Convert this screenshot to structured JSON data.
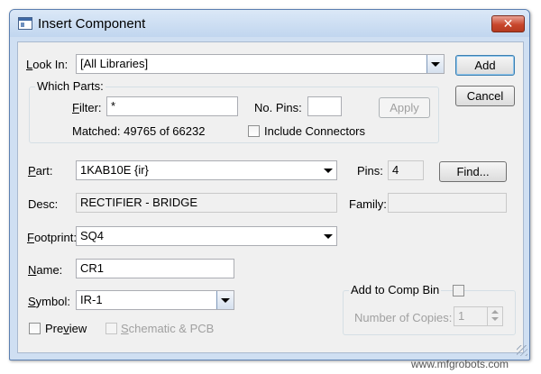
{
  "window": {
    "title": "Insert Component",
    "close_glyph": "✕"
  },
  "look_in": {
    "label_pre": "",
    "label_u": "L",
    "label_post": "ook In:",
    "value": "[All Libraries]"
  },
  "buttons": {
    "add": "Add",
    "cancel": "Cancel",
    "apply": "Apply",
    "find": "Find..."
  },
  "which_parts": {
    "title": "Which Parts:",
    "filter_label_u": "F",
    "filter_label_post": "ilter:",
    "filter_value": "*",
    "no_pins_label": "No. Pins:",
    "no_pins_value": "",
    "matched": "Matched: 49765 of 66232",
    "include_connectors": "Include Connectors"
  },
  "part": {
    "label_u": "P",
    "label_post": "art:",
    "value": "1KAB10E {ir}"
  },
  "pins": {
    "label": "Pins:",
    "value": "4"
  },
  "desc": {
    "label": "Desc:",
    "value": "RECTIFIER - BRIDGE"
  },
  "family": {
    "label": "Family:",
    "value": ""
  },
  "footprint": {
    "label_u": "F",
    "label_post": "ootprint:",
    "value": "SQ4"
  },
  "name": {
    "label_u": "N",
    "label_post": "ame:",
    "value": "CR1"
  },
  "symbol": {
    "label_u": "S",
    "label_post": "ymbol:",
    "value": "IR-1"
  },
  "preview": {
    "label_pre": "Pre",
    "label_u": "v",
    "label_post": "iew"
  },
  "schematic_pcb": {
    "label_u": "S",
    "label_post": "chematic & PCB"
  },
  "comp_bin": {
    "title": "Add to Comp Bin",
    "copies_label": "Number of Copies:",
    "copies_value": "1"
  },
  "watermark": "www.mfgrobots.com"
}
